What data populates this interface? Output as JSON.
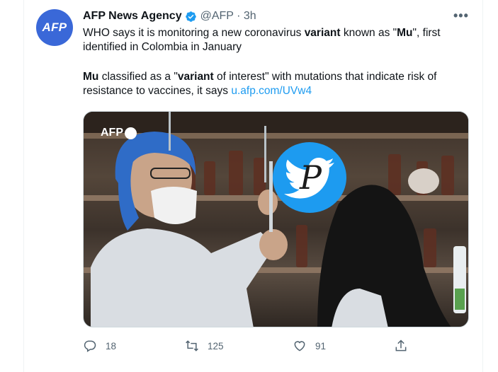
{
  "tweet": {
    "avatar_text": "AFP",
    "author_name": "AFP News Agency",
    "handle_time": "@AFP · 3h",
    "more_label": "•••",
    "paragraph1": {
      "t1": "WHO says it is monitoring a new coronavirus ",
      "b1": "variant",
      "t2": " known as \"",
      "b2": "Mu",
      "t3": "\", first identified in Colombia in January"
    },
    "paragraph2": {
      "b1": "Mu",
      "t1": " classified as a \"",
      "b2": "variant",
      "t2": " of interest\" with mutations that indicate risk of resistance to vaccines, it says ",
      "link": "u.afp.com/UVw4"
    },
    "media": {
      "logo_text": "AFP",
      "watermark_letter": "P",
      "watermark_icon": "twitter-bird-icon"
    },
    "actions": {
      "replies": "18",
      "retweets": "125",
      "likes": "91"
    }
  },
  "colors": {
    "link": "#1d9bf0",
    "avatar": "#3a68d8",
    "muted": "#536471"
  }
}
